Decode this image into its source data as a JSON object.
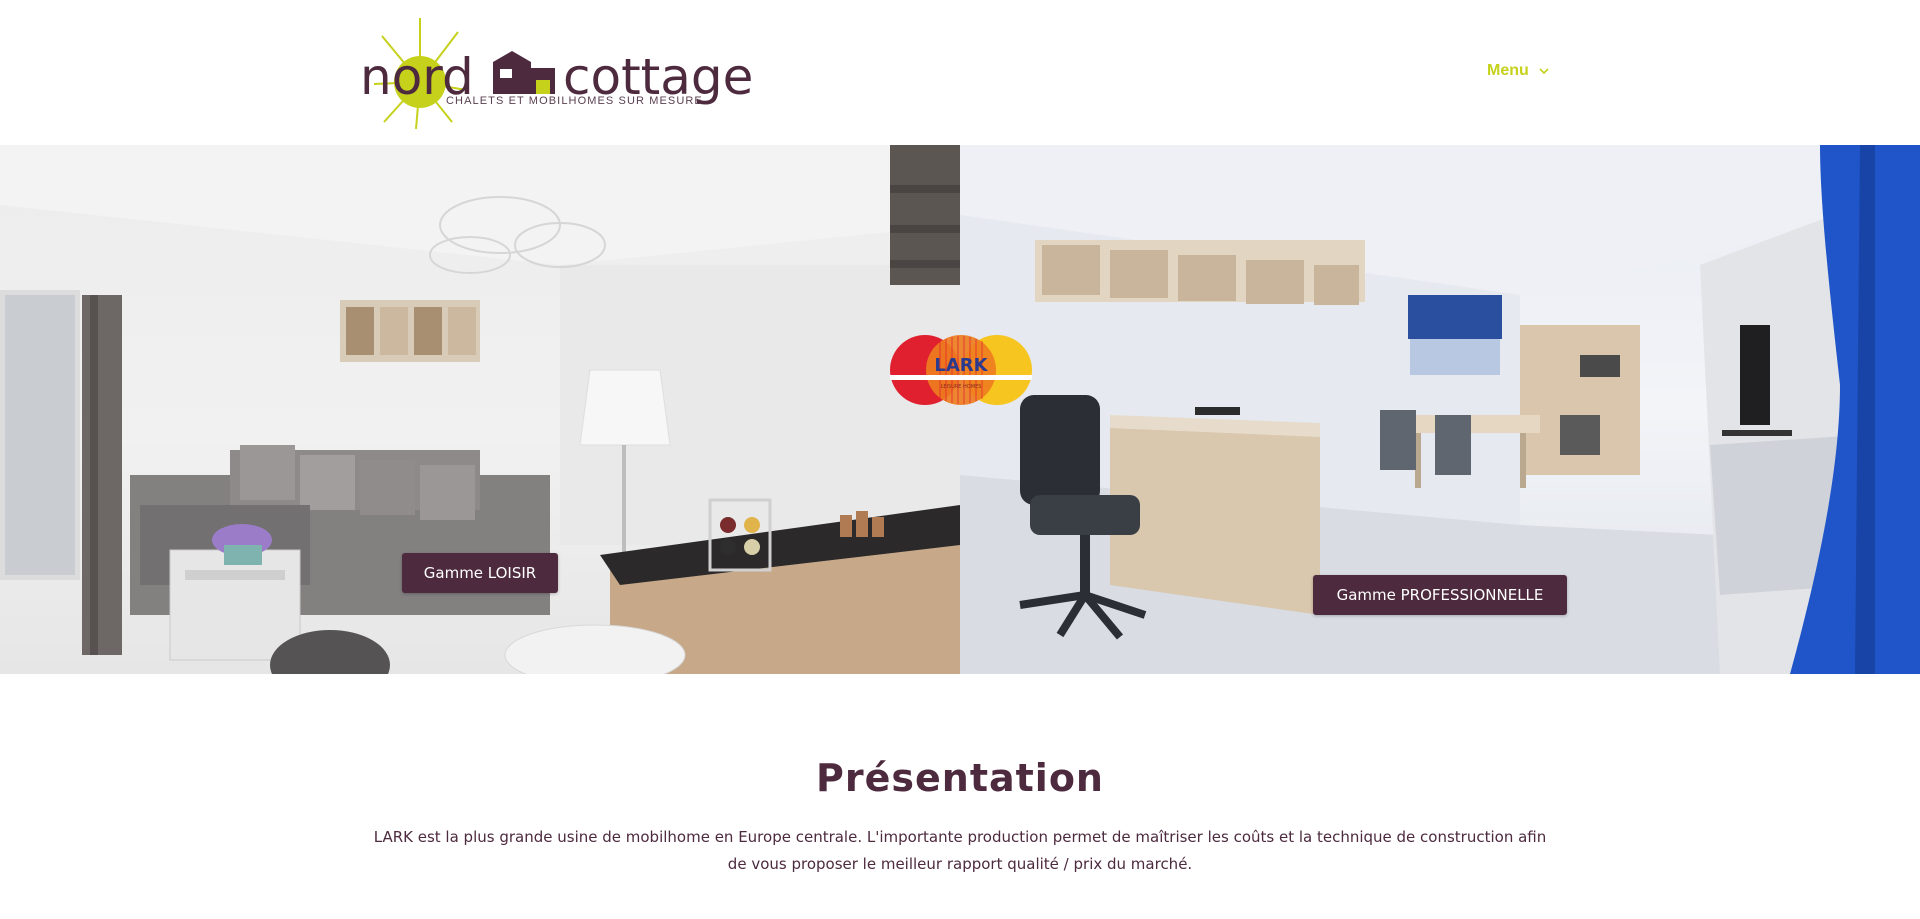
{
  "header": {
    "logo_word_left": "nord",
    "logo_word_right": "cottage",
    "logo_tagline": "CHALETS ET MOBILHOMES SUR MESURE",
    "menu_label": "Menu",
    "menu_icon": "chevron-down-icon"
  },
  "hero": {
    "left_button": "Gamme LOISIR",
    "right_button": "Gamme PROFESSIONNELLE",
    "brand_logo_text": "LARK",
    "brand_logo_subtext": "LEISURE HOMES"
  },
  "presentation": {
    "title": "Présentation",
    "body": "LARK est la plus grande usine de mobilhome en Europe centrale. L'importante production permet de maîtriser les coûts et la technique de construction afin de vous proposer le meilleur rapport qualité / prix du marché."
  },
  "colors": {
    "brand_plum": "#4d2a3e",
    "brand_lime": "#c5d11a",
    "lark_red": "#e0202f",
    "lark_orange": "#ee7d1f",
    "lark_yellow": "#f7c51f"
  }
}
